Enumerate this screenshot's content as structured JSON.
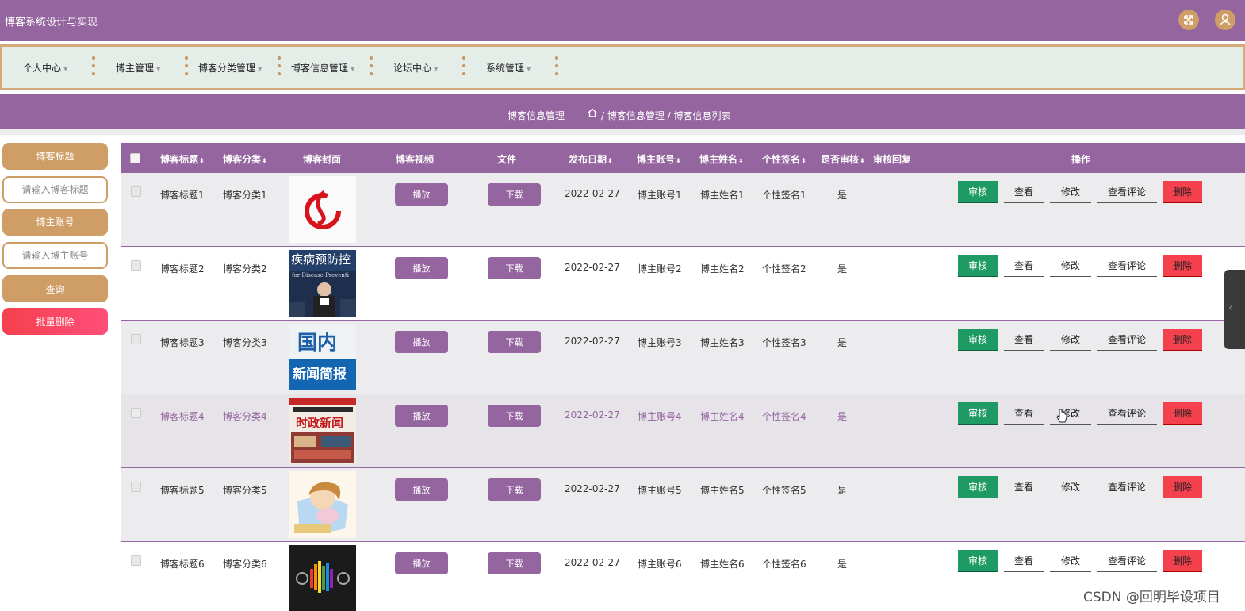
{
  "app": {
    "title": "博客系统设计与实现"
  },
  "top_icons": [
    "fullscreen-icon",
    "user-icon"
  ],
  "nav": {
    "items": [
      "个人中心",
      "博主管理",
      "博客分类管理",
      "博客信息管理",
      "论坛中心",
      "系统管理"
    ]
  },
  "breadcrumb": {
    "title": "博客信息管理",
    "path": "/ 博客信息管理 / 博客信息列表"
  },
  "sidebar": {
    "title_label": "博客标题",
    "title_placeholder": "请输入博客标题",
    "account_label": "博主账号",
    "account_placeholder": "请输入博主账号",
    "search_button": "查询",
    "batch_delete_button": "批量删除"
  },
  "colors": {
    "primary": "#95659f",
    "accent": "#cf9d66",
    "nav_bg": "#e4ede8",
    "audit": "#1e9a65",
    "delete": "#f5404d"
  },
  "table": {
    "headers": {
      "title": "博客标题",
      "category": "博客分类",
      "cover": "博客封面",
      "video": "博客视频",
      "file": "文件",
      "date": "发布日期",
      "account": "博主账号",
      "name": "博主姓名",
      "signature": "个性签名",
      "audited": "是否审核",
      "reply": "审核回复",
      "actions": "操作"
    },
    "sort_glyph": "⬍",
    "play_label": "播放",
    "download_label": "下载",
    "action_labels": {
      "audit": "审核",
      "view": "查看",
      "edit": "修改",
      "comments": "查看评论",
      "delete": "删除"
    },
    "cover_texts": {
      "r2_line1": "疾病预防控",
      "r2_line2": "for Disease Preventi",
      "r3_line1": "国内",
      "r3_line2": "新闻简报",
      "r4_line": "时政新闻"
    },
    "rows": [
      {
        "title": "博客标题1",
        "category": "博客分类1",
        "date": "2022-02-27",
        "account": "博主账号1",
        "name": "博主姓名1",
        "signature": "个性签名1",
        "audited": "是",
        "reply": ""
      },
      {
        "title": "博客标题2",
        "category": "博客分类2",
        "date": "2022-02-27",
        "account": "博主账号2",
        "name": "博主姓名2",
        "signature": "个性签名2",
        "audited": "是",
        "reply": ""
      },
      {
        "title": "博客标题3",
        "category": "博客分类3",
        "date": "2022-02-27",
        "account": "博主账号3",
        "name": "博主姓名3",
        "signature": "个性签名3",
        "audited": "是",
        "reply": ""
      },
      {
        "title": "博客标题4",
        "category": "博客分类4",
        "date": "2022-02-27",
        "account": "博主账号4",
        "name": "博主姓名4",
        "signature": "个性签名4",
        "audited": "是",
        "reply": ""
      },
      {
        "title": "博客标题5",
        "category": "博客分类5",
        "date": "2022-02-27",
        "account": "博主账号5",
        "name": "博主姓名5",
        "signature": "个性签名5",
        "audited": "是",
        "reply": ""
      },
      {
        "title": "博客标题6",
        "category": "博客分类6",
        "date": "2022-02-27",
        "account": "博主账号6",
        "name": "博主姓名6",
        "signature": "个性签名6",
        "audited": "是",
        "reply": ""
      }
    ]
  },
  "watermark": "CSDN @回明毕设项目"
}
